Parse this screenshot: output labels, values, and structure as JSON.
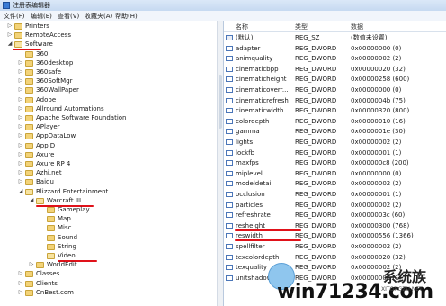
{
  "window": {
    "title": "注册表编辑器"
  },
  "menu": [
    "文件(F)",
    "编辑(E)",
    "查看(V)",
    "收藏夹(A)",
    "帮助(H)"
  ],
  "tree": [
    {
      "label": "Printers",
      "indent": 1,
      "arrow": "▷",
      "open": false
    },
    {
      "label": "RemoteAccess",
      "indent": 1,
      "arrow": "▷",
      "open": false
    },
    {
      "label": "Software",
      "indent": 1,
      "arrow": "◢",
      "open": true
    },
    {
      "label": "360",
      "indent": 2,
      "arrow": "",
      "open": false
    },
    {
      "label": "360desktop",
      "indent": 2,
      "arrow": "▷",
      "open": false
    },
    {
      "label": "360safe",
      "indent": 2,
      "arrow": "▷",
      "open": false
    },
    {
      "label": "360SoftMgr",
      "indent": 2,
      "arrow": "▷",
      "open": false
    },
    {
      "label": "360WallPaper",
      "indent": 2,
      "arrow": "▷",
      "open": false
    },
    {
      "label": "Adobe",
      "indent": 2,
      "arrow": "▷",
      "open": false
    },
    {
      "label": "Allround Automations",
      "indent": 2,
      "arrow": "▷",
      "open": false
    },
    {
      "label": "Apache Software Foundation",
      "indent": 2,
      "arrow": "▷",
      "open": false
    },
    {
      "label": "APlayer",
      "indent": 2,
      "arrow": "▷",
      "open": false
    },
    {
      "label": "AppDataLow",
      "indent": 2,
      "arrow": "▷",
      "open": false
    },
    {
      "label": "AppID",
      "indent": 2,
      "arrow": "▷",
      "open": false
    },
    {
      "label": "Axure",
      "indent": 2,
      "arrow": "▷",
      "open": false
    },
    {
      "label": "Axure RP 4",
      "indent": 2,
      "arrow": "▷",
      "open": false
    },
    {
      "label": "Azhi.net",
      "indent": 2,
      "arrow": "▷",
      "open": false
    },
    {
      "label": "Baidu",
      "indent": 2,
      "arrow": "▷",
      "open": false
    },
    {
      "label": "Blizzard Entertainment",
      "indent": 2,
      "arrow": "◢",
      "open": true
    },
    {
      "label": "Warcraft III",
      "indent": 3,
      "arrow": "◢",
      "open": true
    },
    {
      "label": "Gameplay",
      "indent": 4,
      "arrow": "",
      "open": false
    },
    {
      "label": "Map",
      "indent": 4,
      "arrow": "",
      "open": false
    },
    {
      "label": "Misc",
      "indent": 4,
      "arrow": "",
      "open": false
    },
    {
      "label": "Sound",
      "indent": 4,
      "arrow": "",
      "open": false
    },
    {
      "label": "String",
      "indent": 4,
      "arrow": "",
      "open": false
    },
    {
      "label": "Video",
      "indent": 4,
      "arrow": "",
      "open": true
    },
    {
      "label": "WorldEdit",
      "indent": 3,
      "arrow": "▷",
      "open": false
    },
    {
      "label": "Classes",
      "indent": 2,
      "arrow": "▷",
      "open": false
    },
    {
      "label": "Clients",
      "indent": 2,
      "arrow": "▷",
      "open": false
    },
    {
      "label": "CnBest.com",
      "indent": 2,
      "arrow": "▷",
      "open": false
    }
  ],
  "columns": {
    "name": "名称",
    "type": "类型",
    "data": "数据"
  },
  "values": [
    {
      "name": "(默认)",
      "type": "REG_SZ",
      "data": "(数值未设置)",
      "icon": "string"
    },
    {
      "name": "adapter",
      "type": "REG_DWORD",
      "data": "0x00000000 (0)",
      "icon": "dword"
    },
    {
      "name": "animquality",
      "type": "REG_DWORD",
      "data": "0x00000002 (2)",
      "icon": "dword"
    },
    {
      "name": "cinematicbpp",
      "type": "REG_DWORD",
      "data": "0x00000020 (32)",
      "icon": "dword"
    },
    {
      "name": "cinematicheight",
      "type": "REG_DWORD",
      "data": "0x00000258 (600)",
      "icon": "dword"
    },
    {
      "name": "cinematicoverr...",
      "type": "REG_DWORD",
      "data": "0x00000000 (0)",
      "icon": "dword"
    },
    {
      "name": "cinematicrefresh",
      "type": "REG_DWORD",
      "data": "0x0000004b (75)",
      "icon": "dword"
    },
    {
      "name": "cinematicwidth",
      "type": "REG_DWORD",
      "data": "0x00000320 (800)",
      "icon": "dword"
    },
    {
      "name": "colordepth",
      "type": "REG_DWORD",
      "data": "0x00000010 (16)",
      "icon": "dword"
    },
    {
      "name": "gamma",
      "type": "REG_DWORD",
      "data": "0x0000001e (30)",
      "icon": "dword"
    },
    {
      "name": "lights",
      "type": "REG_DWORD",
      "data": "0x00000002 (2)",
      "icon": "dword"
    },
    {
      "name": "lockfb",
      "type": "REG_DWORD",
      "data": "0x00000001 (1)",
      "icon": "dword"
    },
    {
      "name": "maxfps",
      "type": "REG_DWORD",
      "data": "0x000000c8 (200)",
      "icon": "dword"
    },
    {
      "name": "miplevel",
      "type": "REG_DWORD",
      "data": "0x00000000 (0)",
      "icon": "dword"
    },
    {
      "name": "modeldetail",
      "type": "REG_DWORD",
      "data": "0x00000002 (2)",
      "icon": "dword"
    },
    {
      "name": "occlusion",
      "type": "REG_DWORD",
      "data": "0x00000001 (1)",
      "icon": "dword"
    },
    {
      "name": "particles",
      "type": "REG_DWORD",
      "data": "0x00000002 (2)",
      "icon": "dword"
    },
    {
      "name": "refreshrate",
      "type": "REG_DWORD",
      "data": "0x0000003c (60)",
      "icon": "dword"
    },
    {
      "name": "resheight",
      "type": "REG_DWORD",
      "data": "0x00000300 (768)",
      "icon": "dword"
    },
    {
      "name": "reswidth",
      "type": "REG_DWORD",
      "data": "0x00000556 (1366)",
      "icon": "dword"
    },
    {
      "name": "spellfilter",
      "type": "REG_DWORD",
      "data": "0x00000002 (2)",
      "icon": "dword"
    },
    {
      "name": "texcolordepth",
      "type": "REG_DWORD",
      "data": "0x00000020 (32)",
      "icon": "dword"
    },
    {
      "name": "texquality",
      "type": "REG_DWORD",
      "data": "0x00000002 (2)",
      "icon": "dword"
    },
    {
      "name": "unitshadows",
      "type": "REG_DWORD",
      "data": "0x00000001 (1)",
      "icon": "dword"
    }
  ],
  "watermark": {
    "main": "win71234.com",
    "cn": "系统族",
    "en": "XITONGZU.NET"
  },
  "colors": {
    "highlight": "#e0121a",
    "folder": "#f3d378"
  }
}
